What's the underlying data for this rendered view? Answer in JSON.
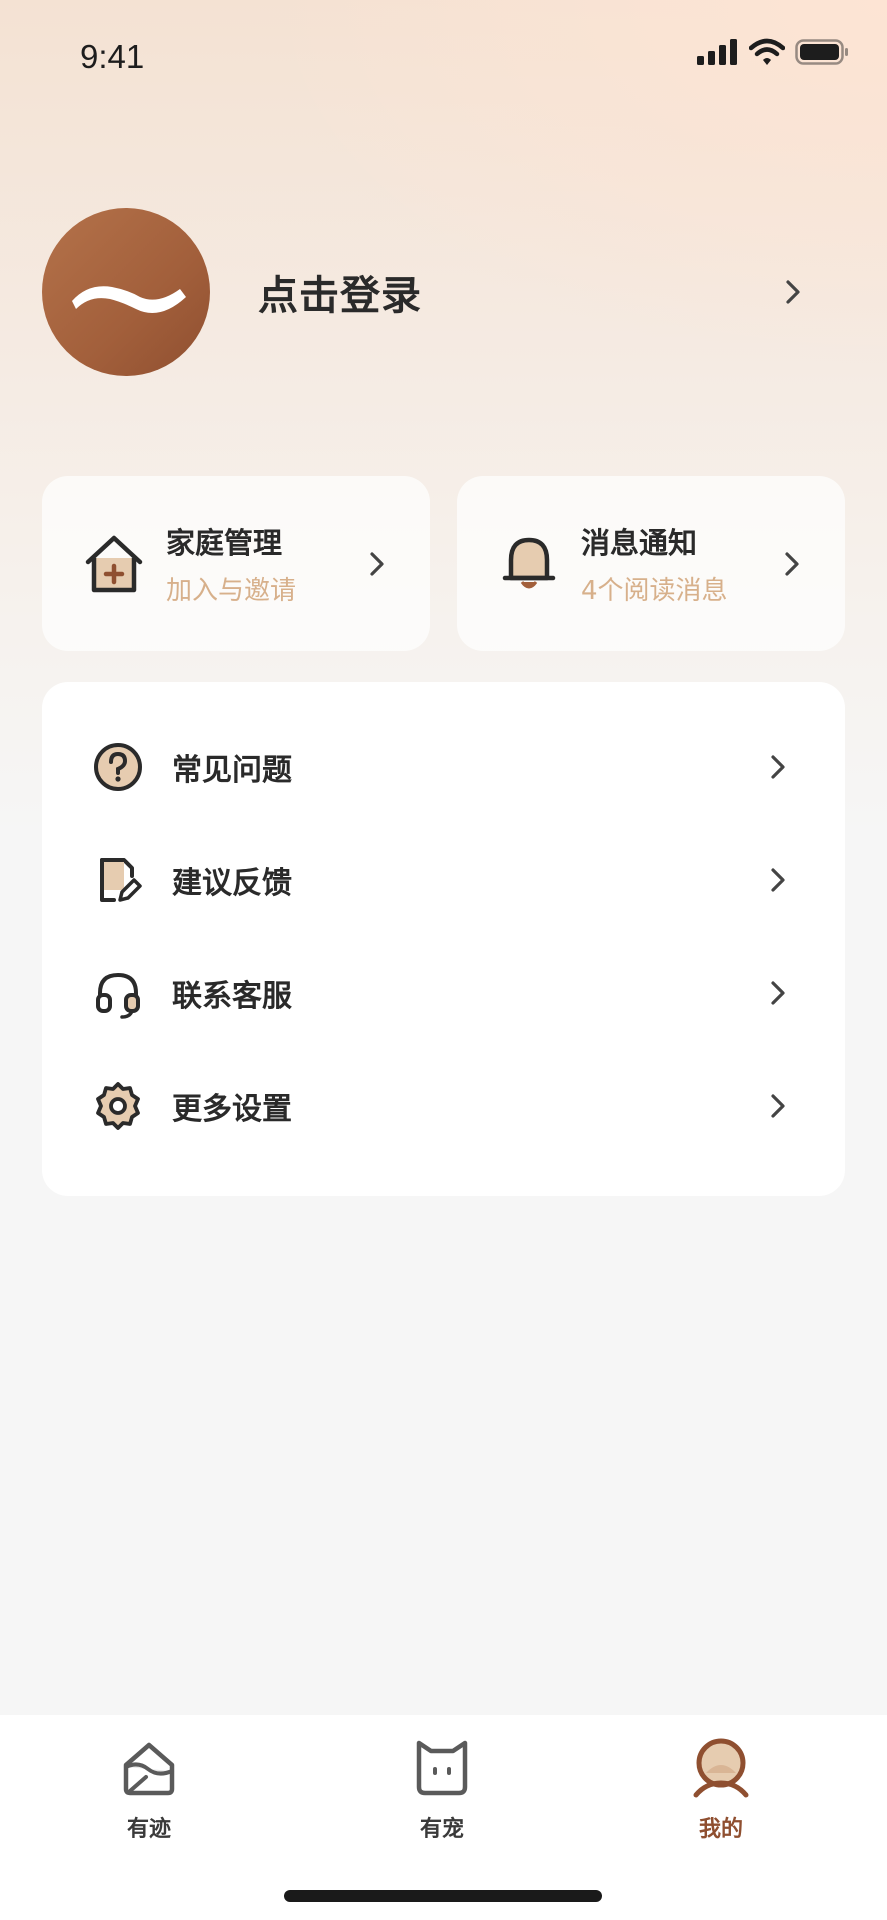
{
  "status_bar": {
    "time": "9:41"
  },
  "profile": {
    "login_label": "点击登录"
  },
  "quick_cards": [
    {
      "title": "家庭管理",
      "subtitle": "加入与邀请",
      "icon": "house-plus-icon"
    },
    {
      "title": "消息通知",
      "subtitle": "4个阅读消息",
      "icon": "bell-icon"
    }
  ],
  "menu": [
    {
      "label": "常见问题",
      "icon": "question-circle-icon"
    },
    {
      "label": "建议反馈",
      "icon": "document-edit-icon"
    },
    {
      "label": "联系客服",
      "icon": "headset-icon"
    },
    {
      "label": "更多设置",
      "icon": "gear-icon"
    }
  ],
  "tabbar": {
    "tabs": [
      {
        "label": "有迹",
        "icon": "mail-footprint-icon",
        "active": false
      },
      {
        "label": "有宠",
        "icon": "cat-face-icon",
        "active": false
      },
      {
        "label": "我的",
        "icon": "profile-icon",
        "active": true
      }
    ]
  },
  "colors": {
    "accent": "#a25f3b",
    "subtitle": "#d7b08b",
    "icon_fill": "#e6ccb0"
  }
}
